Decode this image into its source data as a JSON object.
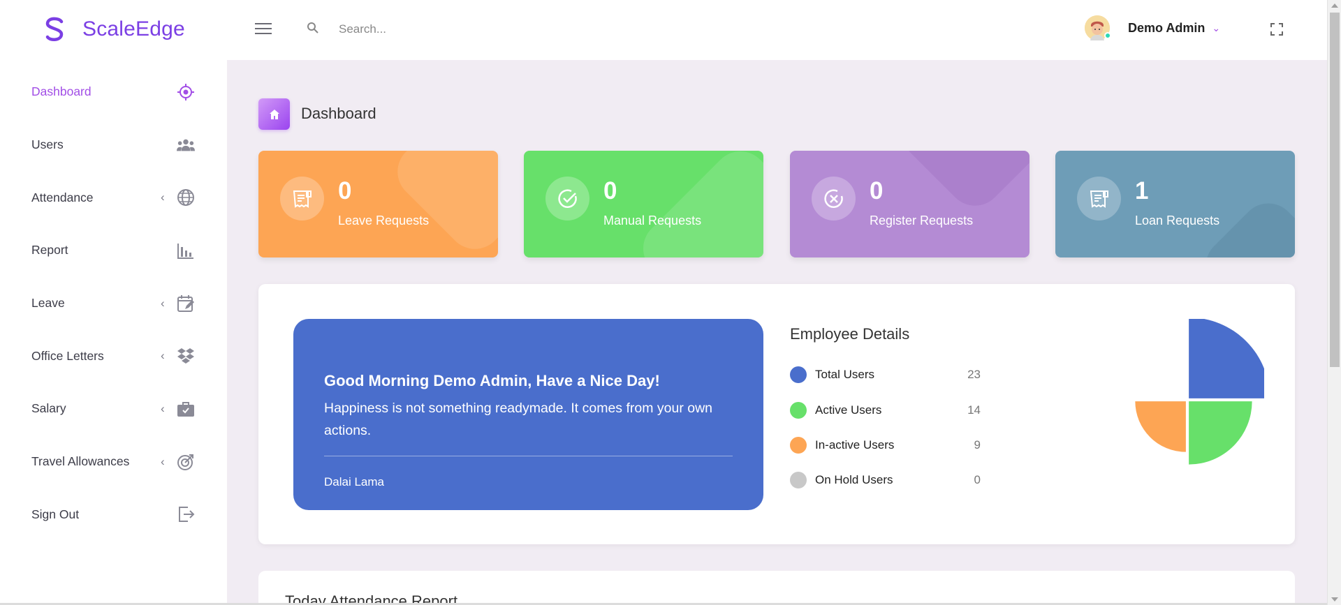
{
  "brand": {
    "name": "ScaleEdge"
  },
  "sidebar": {
    "items": [
      {
        "label": "Dashboard",
        "icon": "crosshair-icon",
        "submenu": false,
        "active": true
      },
      {
        "label": "Users",
        "icon": "users-icon",
        "submenu": false,
        "active": false
      },
      {
        "label": "Attendance",
        "icon": "globe-icon",
        "submenu": true,
        "active": false
      },
      {
        "label": "Report",
        "icon": "bar-chart-icon",
        "submenu": false,
        "active": false
      },
      {
        "label": "Leave",
        "icon": "calendar-edit-icon",
        "submenu": true,
        "active": false
      },
      {
        "label": "Office Letters",
        "icon": "dropbox-icon",
        "submenu": true,
        "active": false
      },
      {
        "label": "Salary",
        "icon": "briefcase-icon",
        "submenu": true,
        "active": false
      },
      {
        "label": "Travel Allowances",
        "icon": "target-arrow-icon",
        "submenu": true,
        "active": false
      },
      {
        "label": "Sign Out",
        "icon": "sign-out-icon",
        "submenu": false,
        "active": false
      }
    ]
  },
  "header": {
    "search_placeholder": "Search...",
    "user_name": "Demo Admin"
  },
  "page": {
    "title": "Dashboard"
  },
  "stats": [
    {
      "count": "0",
      "label": "Leave Requests",
      "color": "#fda554",
      "icon": "receipt-icon"
    },
    {
      "count": "0",
      "label": "Manual Requests",
      "color": "#67e06a",
      "icon": "check-circle-icon"
    },
    {
      "count": "0",
      "label": "Register Requests",
      "color": "#b48bd4",
      "icon": "x-circle-icon"
    },
    {
      "count": "1",
      "label": "Loan Requests",
      "color": "#6e9db7",
      "icon": "receipt-icon"
    }
  ],
  "quote": {
    "greeting": "Good Morning Demo Admin, Have a Nice Day!",
    "text": "Happiness is not something readymade. It comes from your own actions.",
    "author": "Dalai Lama"
  },
  "employee_details": {
    "title": "Employee Details",
    "rows": [
      {
        "label": "Total Users",
        "value": "23",
        "color": "#4a6ecc"
      },
      {
        "label": "Active Users",
        "value": "14",
        "color": "#67e06a"
      },
      {
        "label": "In-active Users",
        "value": "9",
        "color": "#fda554"
      },
      {
        "label": "On Hold Users",
        "value": "0",
        "color": "#c8c8c8"
      }
    ]
  },
  "chart_data": {
    "type": "pie",
    "categories": [
      "Total Users",
      "Active Users",
      "In-active Users",
      "On Hold Users"
    ],
    "values": [
      23,
      14,
      9,
      0
    ],
    "colors": [
      "#4a6ecc",
      "#67e06a",
      "#fda554",
      "#c8c8c8"
    ]
  },
  "attendance_report": {
    "title": "Today Attendance Report"
  }
}
